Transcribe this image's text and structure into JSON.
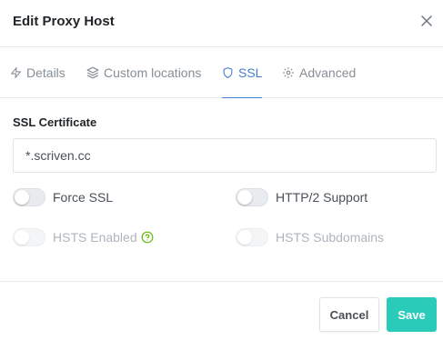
{
  "modal": {
    "title": "Edit Proxy Host"
  },
  "tabs": [
    {
      "label": "Details",
      "icon": "zap-icon",
      "active": false
    },
    {
      "label": "Custom locations",
      "icon": "layers-icon",
      "active": false
    },
    {
      "label": "SSL",
      "icon": "shield-icon",
      "active": true
    },
    {
      "label": "Advanced",
      "icon": "settings-icon",
      "active": false
    }
  ],
  "ssl": {
    "certificate_label": "SSL Certificate",
    "certificate_value": "*.scriven.cc",
    "switches": {
      "force_ssl": {
        "label": "Force SSL",
        "checked": false,
        "disabled": false
      },
      "http2": {
        "label": "HTTP/2 Support",
        "checked": false,
        "disabled": false
      },
      "hsts": {
        "label": "HSTS Enabled",
        "checked": false,
        "disabled": true
      },
      "hsts_subdomains": {
        "label": "HSTS Subdomains",
        "checked": false,
        "disabled": true
      }
    }
  },
  "footer": {
    "cancel_label": "Cancel",
    "save_label": "Save"
  },
  "colors": {
    "accent": "#467fcf",
    "save": "#2bcbba",
    "help_icon": "#5eba00"
  }
}
